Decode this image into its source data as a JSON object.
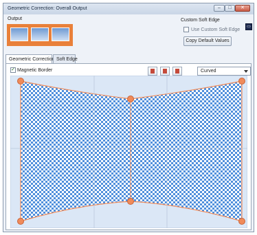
{
  "window": {
    "title": "Geometric Correction: Overall Output",
    "min_glyph": "–",
    "max_glyph": "□",
    "close_glyph": "✕"
  },
  "output": {
    "label": "Output",
    "segments": 3
  },
  "custom_soft_edge": {
    "heading": "Custom Soft Edge",
    "checkbox_label": "Use Custom Soft Edge",
    "checked": false,
    "copy_button": "Copy Default Values"
  },
  "monitor_icon_glyph": "▭",
  "tabs": [
    {
      "label": "Geometric Correction",
      "active": true
    },
    {
      "label": "Soft Edge",
      "active": false
    }
  ],
  "magnetic_border": {
    "label": "Magnetic Border",
    "checked": true,
    "glyph": "✓"
  },
  "toolbar_icons": [
    "align-top-left-icon",
    "align-top-right-icon",
    "align-left-icon",
    "align-right-icon",
    "align-top-icon"
  ],
  "curve_mode": {
    "value": "Curved"
  },
  "colors": {
    "accent": "#e9803a",
    "checker_a": "#4f8fdc",
    "checker_b": "#ffffff",
    "region_tint": "#dbe7f6",
    "control_point": "#f08b5a"
  }
}
